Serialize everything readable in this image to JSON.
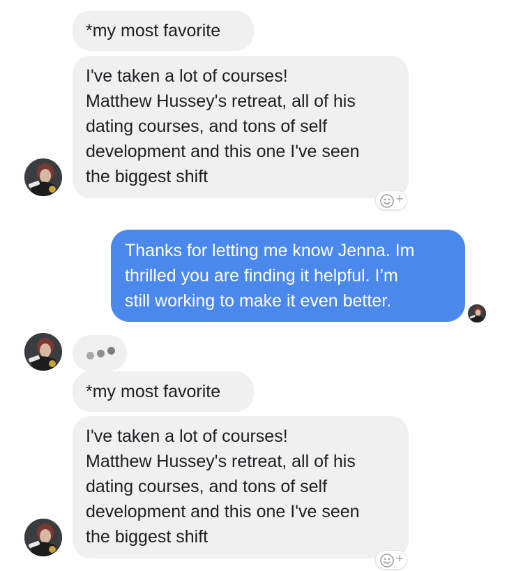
{
  "conversation": {
    "group1": {
      "msg1": "*my most favorite",
      "msg2": [
        "I've taken a lot of courses!",
        "Matthew Hussey's retreat, all of his",
        "dating courses, and tons of self",
        "development and this one I've seen",
        "the biggest shift"
      ]
    },
    "outgoing": [
      "Thanks for letting me know Jenna. Im",
      "thrilled you are finding it helpful. I’m",
      "still working to make it even better."
    ],
    "group2": {
      "msg1": "*my most favorite",
      "msg2": [
        "I've taken a lot of courses!",
        "Matthew Hussey's retreat, all of his",
        "dating courses, and tons of self",
        "development and this one I've seen",
        "the biggest shift"
      ]
    }
  },
  "icons": {
    "reaction": "smiley-plus-icon",
    "avatar": "contact-avatar",
    "typing": "typing-indicator-dots"
  },
  "colors": {
    "incoming_bubble": "#f1f0f0",
    "outgoing_bubble": "#4a88ec"
  }
}
